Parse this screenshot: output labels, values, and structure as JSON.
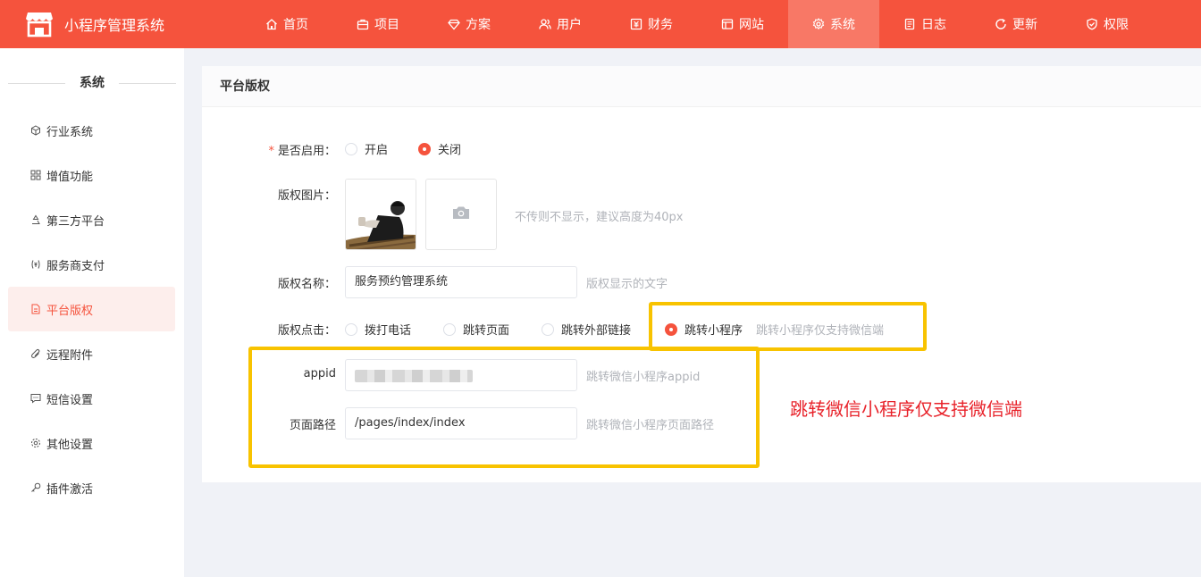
{
  "app": {
    "title": "小程序管理系统",
    "brand_color": "#f5533d"
  },
  "nav": [
    {
      "label": "首页",
      "icon": "home-icon"
    },
    {
      "label": "项目",
      "icon": "briefcase-icon"
    },
    {
      "label": "方案",
      "icon": "diamond-icon"
    },
    {
      "label": "用户",
      "icon": "users-icon"
    },
    {
      "label": "财务",
      "icon": "finance-icon"
    },
    {
      "label": "网站",
      "icon": "website-icon"
    },
    {
      "label": "系统",
      "icon": "gear-icon",
      "active": true
    },
    {
      "label": "日志",
      "icon": "log-icon"
    },
    {
      "label": "更新",
      "icon": "refresh-icon"
    },
    {
      "label": "权限",
      "icon": "shield-icon"
    }
  ],
  "sidebar": {
    "title": "系统",
    "items": [
      {
        "label": "行业系统",
        "icon": "cube-icon"
      },
      {
        "label": "增值功能",
        "icon": "grid-icon"
      },
      {
        "label": "第三方平台",
        "icon": "recycle-icon"
      },
      {
        "label": "服务商支付",
        "icon": "payment-icon"
      },
      {
        "label": "平台版权",
        "icon": "document-icon",
        "active": true
      },
      {
        "label": "远程附件",
        "icon": "paperclip-icon"
      },
      {
        "label": "短信设置",
        "icon": "message-icon"
      },
      {
        "label": "其他设置",
        "icon": "settings-icon"
      },
      {
        "label": "插件激活",
        "icon": "key-icon"
      }
    ]
  },
  "card": {
    "title": "平台版权"
  },
  "form": {
    "enable": {
      "label": "是否启用：",
      "required_mark": "*",
      "options": [
        "开启",
        "关闭"
      ],
      "selected": "关闭"
    },
    "image": {
      "label": "版权图片：",
      "hint": "不传则不显示，建议高度为40px"
    },
    "name": {
      "label": "版权名称：",
      "value": "服务预约管理系统",
      "hint": "版权显示的文字"
    },
    "click": {
      "label": "版权点击：",
      "options": [
        "拨打电话",
        "跳转页面",
        "跳转外部链接",
        "跳转小程序"
      ],
      "selected": "跳转小程序",
      "hint": "跳转小程序仅支持微信端"
    },
    "appid": {
      "label": "appid",
      "value": "",
      "hint": "跳转微信小程序appid"
    },
    "path": {
      "label": "页面路径",
      "value": "/pages/index/index",
      "hint": "跳转微信小程序页面路径"
    }
  },
  "annotation": {
    "text": "跳转微信小程序仅支持微信端",
    "color": "#e8222a",
    "box_color": "#f8c300"
  }
}
